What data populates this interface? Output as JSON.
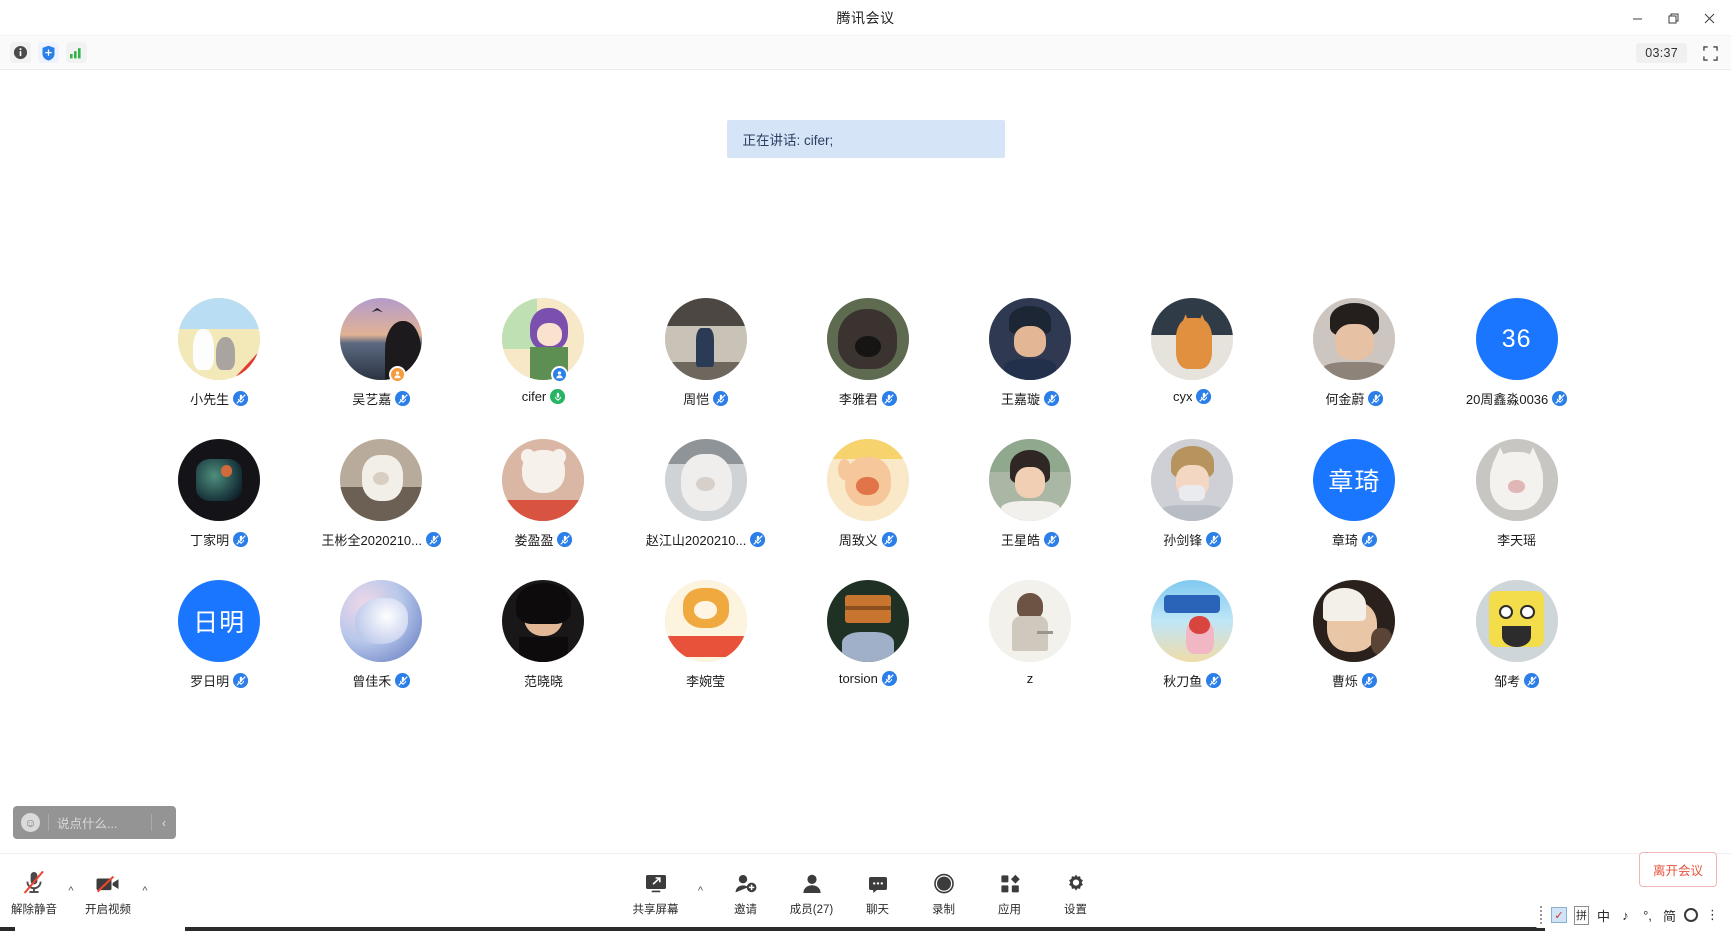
{
  "window": {
    "title": "腾讯会议",
    "minimize_label": "—",
    "maximize_label": "❐",
    "close_label": "✕"
  },
  "subbar": {
    "info_icon": "info-icon",
    "shield_icon": "security-shield-icon",
    "signal_icon": "network-signal-icon",
    "timer": "03:37",
    "fullscreen_icon": "fullscreen-icon"
  },
  "stage": {
    "speaking_banner": "正在讲话: cifer;"
  },
  "chat_input": {
    "emoji_icon": "emoji-icon",
    "placeholder": "说点什么...",
    "collapse_label": "‹"
  },
  "participants": [
    {
      "name": "小先生",
      "avatar_type": "photo",
      "art": "art-umbrella",
      "mic": "muted",
      "corner": "none"
    },
    {
      "name": "吴艺嘉",
      "avatar_type": "photo",
      "art": "art-beach",
      "mic": "muted",
      "corner": "orange"
    },
    {
      "name": "cifer",
      "avatar_type": "photo",
      "art": "art-anime",
      "mic": "active",
      "corner": "blue"
    },
    {
      "name": "周恺",
      "avatar_type": "photo",
      "art": "art-hall",
      "mic": "muted",
      "corner": "none"
    },
    {
      "name": "李雅君",
      "avatar_type": "photo",
      "art": "art-dog",
      "mic": "muted",
      "corner": "none"
    },
    {
      "name": "王嘉璇",
      "avatar_type": "photo",
      "art": "art-portrait",
      "mic": "muted",
      "corner": "none"
    },
    {
      "name": "cyx",
      "avatar_type": "photo",
      "art": "art-cat",
      "mic": "muted",
      "corner": "none"
    },
    {
      "name": "何金蔚",
      "avatar_type": "photo",
      "art": "art-boy",
      "mic": "muted",
      "corner": "none"
    },
    {
      "name": "20周鑫淼0036",
      "avatar_type": "initials",
      "initials": "36",
      "mic": "muted",
      "corner": "none"
    },
    {
      "name": "丁家明",
      "avatar_type": "photo",
      "art": "art-dark",
      "mic": "muted",
      "corner": "none"
    },
    {
      "name": "王彬全2020210...",
      "avatar_type": "photo",
      "art": "art-whitecat",
      "mic": "muted",
      "corner": "none"
    },
    {
      "name": "娄盈盈",
      "avatar_type": "photo",
      "art": "art-bear",
      "mic": "muted",
      "corner": "none"
    },
    {
      "name": "赵江山2020210...",
      "avatar_type": "photo",
      "art": "art-kitten",
      "mic": "muted",
      "corner": "none"
    },
    {
      "name": "周致义",
      "avatar_type": "photo",
      "art": "art-bunny",
      "mic": "muted",
      "corner": "none"
    },
    {
      "name": "王星皓",
      "avatar_type": "photo",
      "art": "art-girl",
      "mic": "muted",
      "corner": "none"
    },
    {
      "name": "孙剑锋",
      "avatar_type": "photo",
      "art": "art-person",
      "mic": "muted",
      "corner": "none"
    },
    {
      "name": "章琦",
      "avatar_type": "initials",
      "initials": "章琦",
      "mic": "muted",
      "corner": "none"
    },
    {
      "name": "李天瑶",
      "avatar_type": "photo",
      "art": "art-whitekit",
      "mic": "none",
      "corner": "none"
    },
    {
      "name": "罗日明",
      "avatar_type": "initials",
      "initials": "日明",
      "mic": "muted",
      "corner": "none"
    },
    {
      "name": "曾佳禾",
      "avatar_type": "photo",
      "art": "art-swirl",
      "mic": "muted",
      "corner": "none"
    },
    {
      "name": "范晓晓",
      "avatar_type": "photo",
      "art": "art-hair",
      "mic": "none",
      "corner": "none"
    },
    {
      "name": "李婉莹",
      "avatar_type": "photo",
      "art": "art-tiger",
      "mic": "none",
      "corner": "none"
    },
    {
      "name": "torsion",
      "avatar_type": "photo",
      "art": "art-box",
      "mic": "muted",
      "corner": "none"
    },
    {
      "name": "z",
      "avatar_type": "photo",
      "art": "art-sketch",
      "mic": "none",
      "corner": "none"
    },
    {
      "name": "秋刀鱼",
      "avatar_type": "photo",
      "art": "art-beachart",
      "mic": "muted",
      "corner": "none"
    },
    {
      "name": "曹烁",
      "avatar_type": "photo",
      "art": "art-baby",
      "mic": "muted",
      "corner": "none"
    },
    {
      "name": "邹考",
      "avatar_type": "photo",
      "art": "art-sponge",
      "mic": "muted",
      "corner": "none"
    }
  ],
  "bottombar": {
    "left": [
      {
        "label": "解除静音",
        "icon": "microphone-muted-icon",
        "chevron": "^"
      },
      {
        "label": "开启视频",
        "icon": "video-off-icon",
        "chevron": "^"
      }
    ],
    "center": [
      {
        "label": "共享屏幕",
        "icon": "share-screen-icon",
        "chevron": "^"
      },
      {
        "label": "邀请",
        "icon": "invite-icon",
        "chevron": ""
      },
      {
        "label": "成员(27)",
        "icon": "members-icon",
        "chevron": ""
      },
      {
        "label": "聊天",
        "icon": "chat-icon",
        "chevron": ""
      },
      {
        "label": "录制",
        "icon": "record-icon",
        "chevron": ""
      },
      {
        "label": "应用",
        "icon": "apps-icon",
        "chevron": ""
      },
      {
        "label": "设置",
        "icon": "settings-gear-icon",
        "chevron": ""
      }
    ],
    "leave_label": "离开会议"
  },
  "ime": {
    "items": [
      "拼",
      "中",
      "♪",
      "°,",
      "简"
    ],
    "check_icon": "ime-check-icon",
    "gear_icon": "ime-gear-icon",
    "more_label": "⋮"
  },
  "colors": {
    "accent_blue": "#1a76ff",
    "mic_muted": "#2b7fe8",
    "mic_active": "#27b562",
    "banner_bg": "#d6e4f7",
    "leave_red": "#e8543f"
  }
}
